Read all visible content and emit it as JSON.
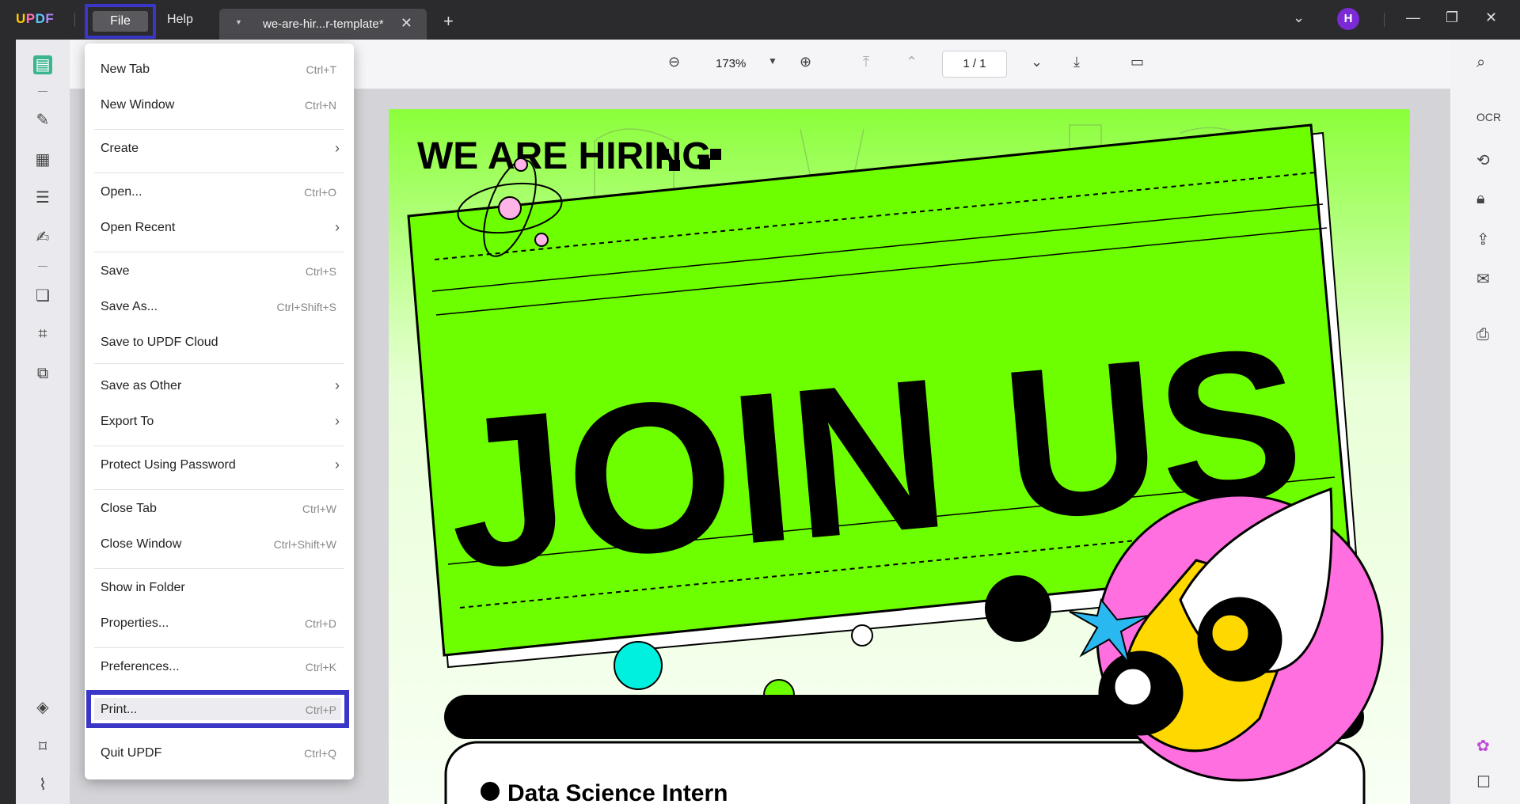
{
  "app": {
    "logo": "UPDF",
    "menu": [
      "File",
      "Help"
    ],
    "tab_title": "we-are-hir...r-template*",
    "avatar_initial": "H"
  },
  "toolbar": {
    "zoom": "173%",
    "page_current": "1",
    "page_sep": "/",
    "page_total": "1"
  },
  "file_menu": {
    "items": [
      {
        "label": "New Tab",
        "shortcut": "Ctrl+T"
      },
      {
        "label": "New Window",
        "shortcut": "Ctrl+N"
      },
      {
        "label": "Create",
        "submenu": true
      },
      {
        "label": "Open...",
        "shortcut": "Ctrl+O"
      },
      {
        "label": "Open Recent",
        "submenu": true
      },
      {
        "label": "Save",
        "shortcut": "Ctrl+S"
      },
      {
        "label": "Save As...",
        "shortcut": "Ctrl+Shift+S"
      },
      {
        "label": "Save to UPDF Cloud"
      },
      {
        "label": "Save as Other",
        "submenu": true
      },
      {
        "label": "Export To",
        "submenu": true
      },
      {
        "label": "Protect Using Password",
        "submenu": true
      },
      {
        "label": "Close Tab",
        "shortcut": "Ctrl+W"
      },
      {
        "label": "Close Window",
        "shortcut": "Ctrl+Shift+W"
      },
      {
        "label": "Show in Folder"
      },
      {
        "label": "Properties...",
        "shortcut": "Ctrl+D"
      },
      {
        "label": "Preferences...",
        "shortcut": "Ctrl+K"
      },
      {
        "label": "Print...",
        "shortcut": "Ctrl+P"
      },
      {
        "label": "Quit UPDF",
        "shortcut": "Ctrl+Q"
      }
    ]
  },
  "document": {
    "heading": "WE ARE HIRING",
    "big_text": "JOIN US",
    "role": "Data Science Intern"
  },
  "colors": {
    "accent": "#3a37c8",
    "poster_green": "#6dff00",
    "poster_pink": "#ff6fe0",
    "poster_yellow": "#ffd800",
    "poster_cyan": "#00f0e0"
  }
}
